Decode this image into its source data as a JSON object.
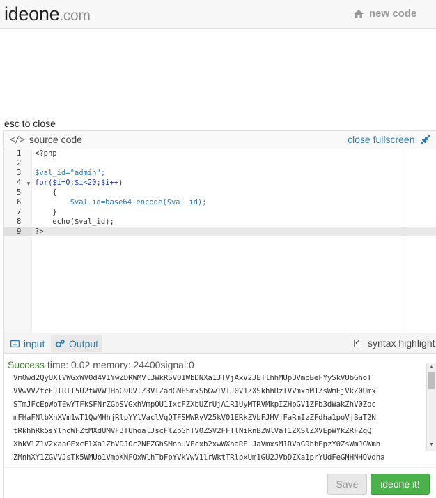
{
  "header": {
    "logo_main": "ideone",
    "logo_suffix": ".com",
    "new_code_label": "new code",
    "new_code_icon": "home-icon"
  },
  "hint": "esc to close",
  "source": {
    "title": "source code",
    "title_icon": "code-icon",
    "close_fullscreen_label": "close fullscreen",
    "close_fullscreen_icon": "collapse-arrows-icon",
    "line_numbers": [
      "1",
      "2",
      "3",
      "4",
      "5",
      "6",
      "7",
      "8",
      "9"
    ],
    "lines": [
      "<?php",
      "",
      "$val_id=\"admin\";",
      "for($i=0;$i<20;$i++)",
      "    {",
      "        $val_id=base64_encode($val_id);",
      "    }",
      "    echo($val_id);",
      "?>"
    ],
    "folded_line": "4"
  },
  "io": {
    "input_tab_label": "input",
    "input_tab_icon": "keyboard-icon",
    "output_tab_label": "Output",
    "output_tab_icon": "gears-icon",
    "syntax_highlight_label": "syntax highlight",
    "syntax_highlight_checked": true
  },
  "result": {
    "status": "Success",
    "time_label": "time:",
    "time_value": "0.02",
    "memory_label": "memory:",
    "memory_value": "24400",
    "signal_label": "signal:",
    "signal_value": "0",
    "output_lines": [
      "Vm0wd2QyUXlVWGxWV0d4V1YwZDRWMVl3WkRSV01WbDNXa1JTVjAxV2JETlhhMUpUVmpBeFYySkVUbGhoT",
      "VVwVVZtcEJlRll5U2tWVWJHaG9UVlZ3VlZadGNFSmxSbGw1VTJ0V1ZXSkhhRzlVVmxaM1ZsWmFjVkZ0Umx",
      "STmJFcEpWbTEwYTFkSFNrZGpSVGxhVmpOU1IxcFZXbUZrUjA1R1UyMTRVMkpIZHpGV1ZFb3dWakZhV0Zoc",
      "mFHaFNlbXhXVm1wT1QwMHhjRlpYYlVaclVqQTFSMWRyV25kV01ERkZVbFJHVjFaRmIzZFdha1poVjBaT2N",
      "tRkhhRk5sYlhoWFZtMXdUMVF3TUhoalJscFlZbGhTV0ZSV2FFTlNiRnBZWlVaT1ZXSlZXVEpWYkZRFZqQ",
      "XhkVlZ1V2xaaGExcFlXa1ZhVDJOc2NFZGhSMnhUVFcxb2xwWXhaRE JaVmxsM1RVaG9hbEpzY0ZsWmJGWmh",
      "ZMnhXY1ZGVVJsTk5WMUo1VmpKNFQxWlhTbFpYVkVwV1lrWktTRlpxUm1GU2JVbDZXa1prYUdFeGNHNHOVdha"
    ]
  },
  "footer": {
    "save_label": "Save",
    "run_label": "ideone it!"
  }
}
